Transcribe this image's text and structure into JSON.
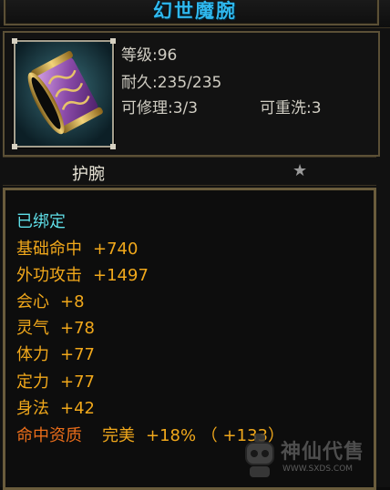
{
  "item": {
    "name": "幻世魔腕",
    "type": "护腕",
    "stats": {
      "level_label": "等级",
      "level_value": ":96",
      "durability_label": "耐久",
      "durability_value": ":235/235",
      "repair_label": "可修理",
      "repair_value": ":3/3",
      "rewash_label": "可重洗",
      "rewash_value": ":3"
    },
    "bound_text": "已绑定",
    "attributes": [
      {
        "name": "基础命中",
        "value": "+740"
      },
      {
        "name": "外功攻击",
        "value": "+1497"
      },
      {
        "name": "会心",
        "value": "+8"
      },
      {
        "name": "灵气",
        "value": "+78"
      },
      {
        "name": "体力",
        "value": "+77"
      },
      {
        "name": "定力",
        "value": "+77"
      },
      {
        "name": "身法",
        "value": "+42"
      }
    ],
    "aptitude": {
      "name": "命中资质",
      "grade": "完美",
      "value": "+18% （ +133）"
    }
  },
  "watermark": {
    "title": "神仙代售",
    "url": "WWW.SXDS.COM"
  },
  "colors": {
    "title": "#2fb8ee",
    "bound": "#5fdfe8",
    "attribute": "#f1a81b",
    "aptitude": "#ea6d1a",
    "frame": "#5b5036"
  },
  "icons": {
    "item_icon": "purple-gold-bracer-icon",
    "favorite": "star-icon",
    "watermark_logo": "robot-mascot-icon"
  }
}
